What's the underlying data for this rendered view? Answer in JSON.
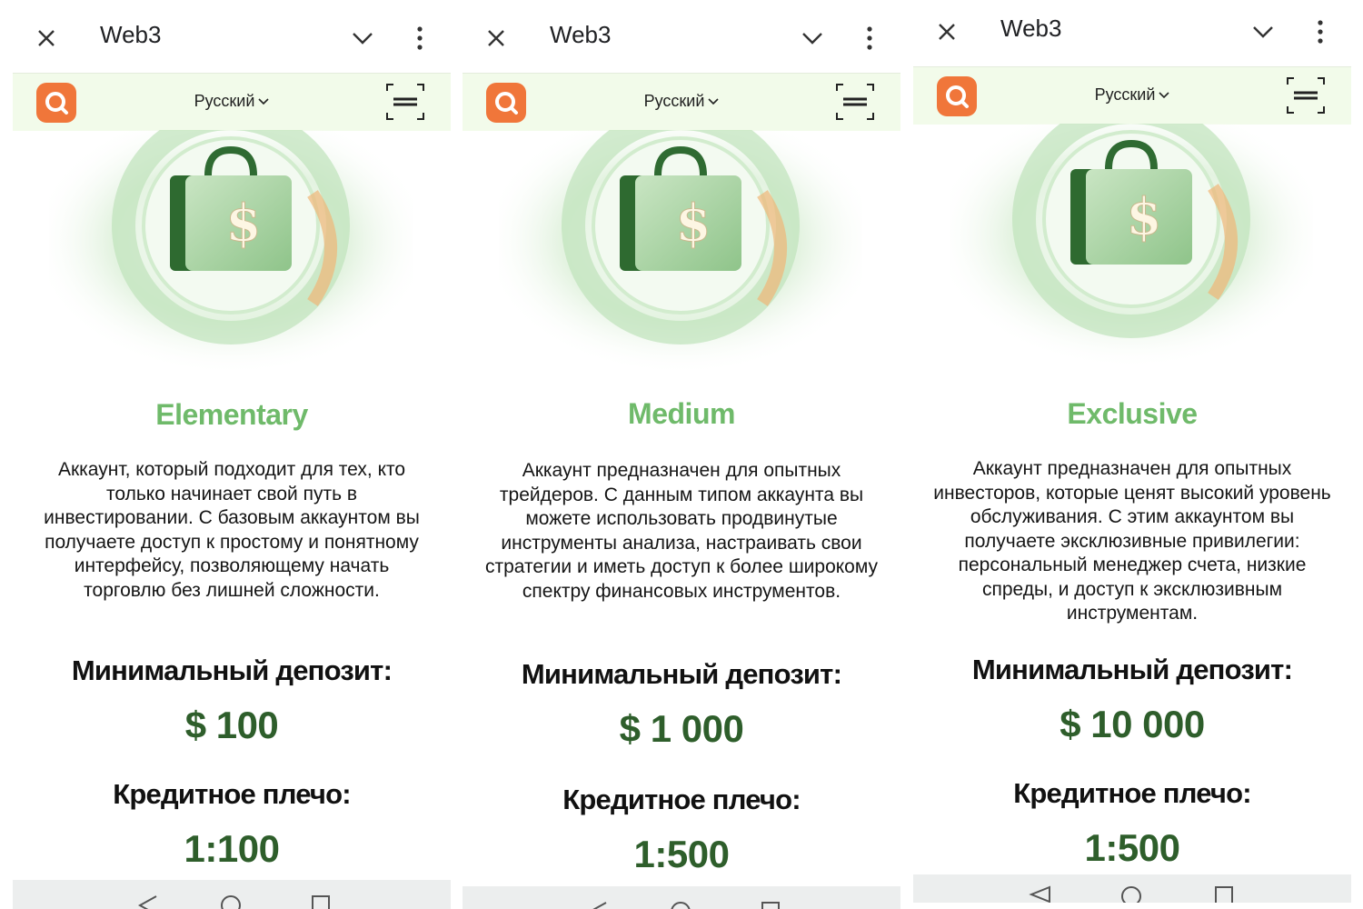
{
  "screens": [
    {
      "browser": {
        "title": "Web3"
      },
      "site": {
        "language": "Русский"
      },
      "plan": {
        "name": "Elementary",
        "description": "Аккаунт, который подходит для тех, кто только начинает свой путь в инвестировании. С базовым аккаунтом вы получаете доступ к простому и понятному интерфейсу, позволяющему начать торговлю без лишней сложности.",
        "deposit_label": "Минимальный депозит:",
        "deposit_value": "$ 100",
        "leverage_label": "Кредитное плечо:",
        "leverage_value": "1:100"
      }
    },
    {
      "browser": {
        "title": "Web3"
      },
      "site": {
        "language": "Русский"
      },
      "plan": {
        "name": "Medium",
        "description": "Аккаунт предназначен для опытных трейдеров. С данным типом аккаунта вы можете использовать продвинутые инструменты анализа, настраивать свои стратегии и иметь доступ к более широкому спектру финансовых инструментов.",
        "deposit_label": "Минимальный депозит:",
        "deposit_value": "$ 1 000",
        "leverage_label": "Кредитное плечо:",
        "leverage_value": "1:500"
      }
    },
    {
      "browser": {
        "title": "Web3"
      },
      "site": {
        "language": "Русский"
      },
      "plan": {
        "name": "Exclusive",
        "description": "Аккаунт предназначен для опытных инвесторов, которые ценят высокий уровень обслуживания. С этим аккаунтом вы получаете эксклюзивные привилегии: персональный менеджер счета, низкие спреды, и доступ к эксклюзивным инструментам.",
        "deposit_label": "Минимальный депозит:",
        "deposit_value": "$ 10 000",
        "leverage_label": "Кредитное плечо:",
        "leverage_value": "1:500"
      }
    }
  ],
  "icons": [
    "close-icon",
    "chevron-down-icon",
    "more-vert-icon",
    "brand-logo-icon",
    "qr-scan-icon",
    "back-icon",
    "home-icon",
    "recents-icon"
  ],
  "colors": {
    "tier": "#6fba6a",
    "value": "#2e5e2b",
    "site_bar": "#f2fbea",
    "logo": "#f0763a"
  }
}
